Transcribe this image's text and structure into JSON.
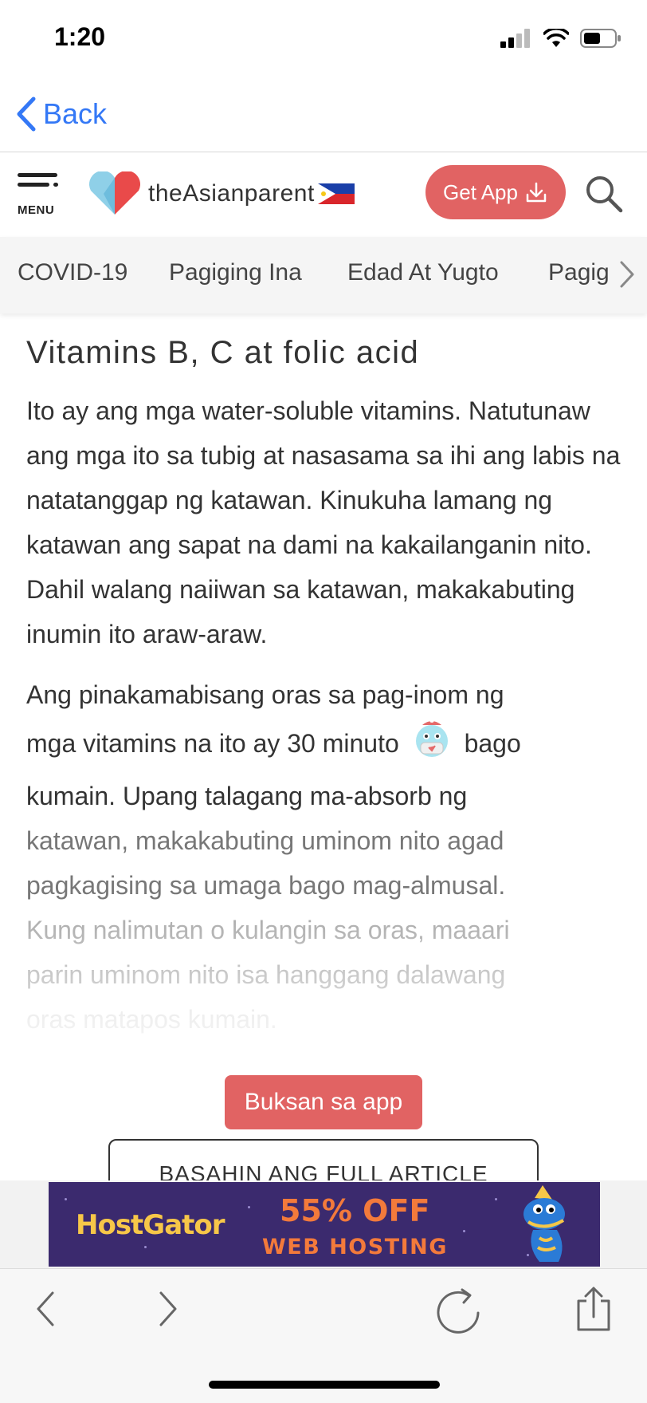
{
  "status_bar": {
    "time": "1:20"
  },
  "nav": {
    "back_label": "Back"
  },
  "header": {
    "menu_label": "MENU",
    "logo_text": "theAsianparent",
    "get_app_label": "Get App"
  },
  "categories": [
    "COVID-19",
    "Pagiging Ina",
    "Edad At Yugto",
    "Pagig"
  ],
  "article": {
    "heading": "Vitamins B, C at folic acid",
    "para1": "Ito ay ang mga water-soluble vitamins. Natutunaw ang mga ito sa tubig at nasasama sa ihi ang labis na natatanggap ng katawan. Kinukuha lamang ng katawan ang sapat na dami na kakailanganin nito. Dahil walang naiiwan sa katawan, makakabuting inumin ito araw-araw.",
    "para2_line1": "Ang pinakamabisang oras sa pag-inom ng",
    "para2_line2a": "mga vitamins na ito ay 30 minuto",
    "para2_line2b": "bago",
    "para2_line3": "kumain. Upang talagang ma-absorb ng",
    "para2_line4": "katawan, makakabuting uminom nito agad",
    "para2_line5": "pagkagising sa umaga bago mag-almusal.",
    "para2_line6": "Kung nalimutan o kulangin sa oras, maaari",
    "para2_line7": "parin uminom nito isa hanggang dalawang",
    "para2_line8": "oras matapos kumain."
  },
  "cta": {
    "open_app_label": "Buksan sa app",
    "full_article_label": "BASAHIN ANG FULL ARTICLE"
  },
  "ad": {
    "brand": "HostGator",
    "offer": "55% OFF",
    "subtitle": "WEB HOSTING"
  },
  "colors": {
    "accent": "#e16363",
    "link": "#3478f6",
    "ad_bg": "#3b2a6e",
    "ad_brand": "#f7c748",
    "ad_offer": "#f37a3b"
  }
}
